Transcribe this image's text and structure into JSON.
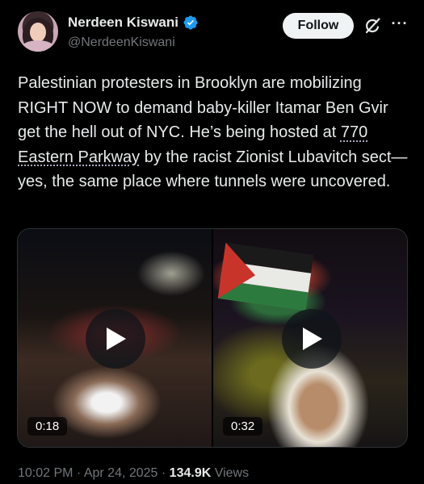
{
  "author": {
    "name": "Nerdeen Kiswani",
    "handle": "@NerdeenKiswani",
    "verified": true,
    "avatar_icon": "avatar"
  },
  "header": {
    "follow_label": "Follow",
    "grok_icon": "grok-icon",
    "more_icon": "more-icon",
    "more_label": "···"
  },
  "tweet": {
    "text_part1": "Palestinian protesters in Brooklyn are mobilizing RIGHT NOW to demand baby-killer Itamar Ben Gvir get the hell out of NYC. He’s being hosted at ",
    "link_text": "770 Eastern Parkway",
    "text_part2": " by the racist Zionist Lubavitch sect—yes, the same place where tunnels were uncovered."
  },
  "media": [
    {
      "duration": "0:18",
      "icon": "play-icon"
    },
    {
      "duration": "0:32",
      "icon": "play-icon"
    }
  ],
  "meta": {
    "time": "10:02 PM",
    "separator": " · ",
    "date": "Apr 24, 2025",
    "views_count": "134.9K",
    "views_label": " Views"
  },
  "colors": {
    "background": "#000000",
    "text": "#e7e9ea",
    "secondary": "#71767b",
    "verified_blue": "#1d9bf0",
    "follow_bg": "#eff3f4"
  }
}
